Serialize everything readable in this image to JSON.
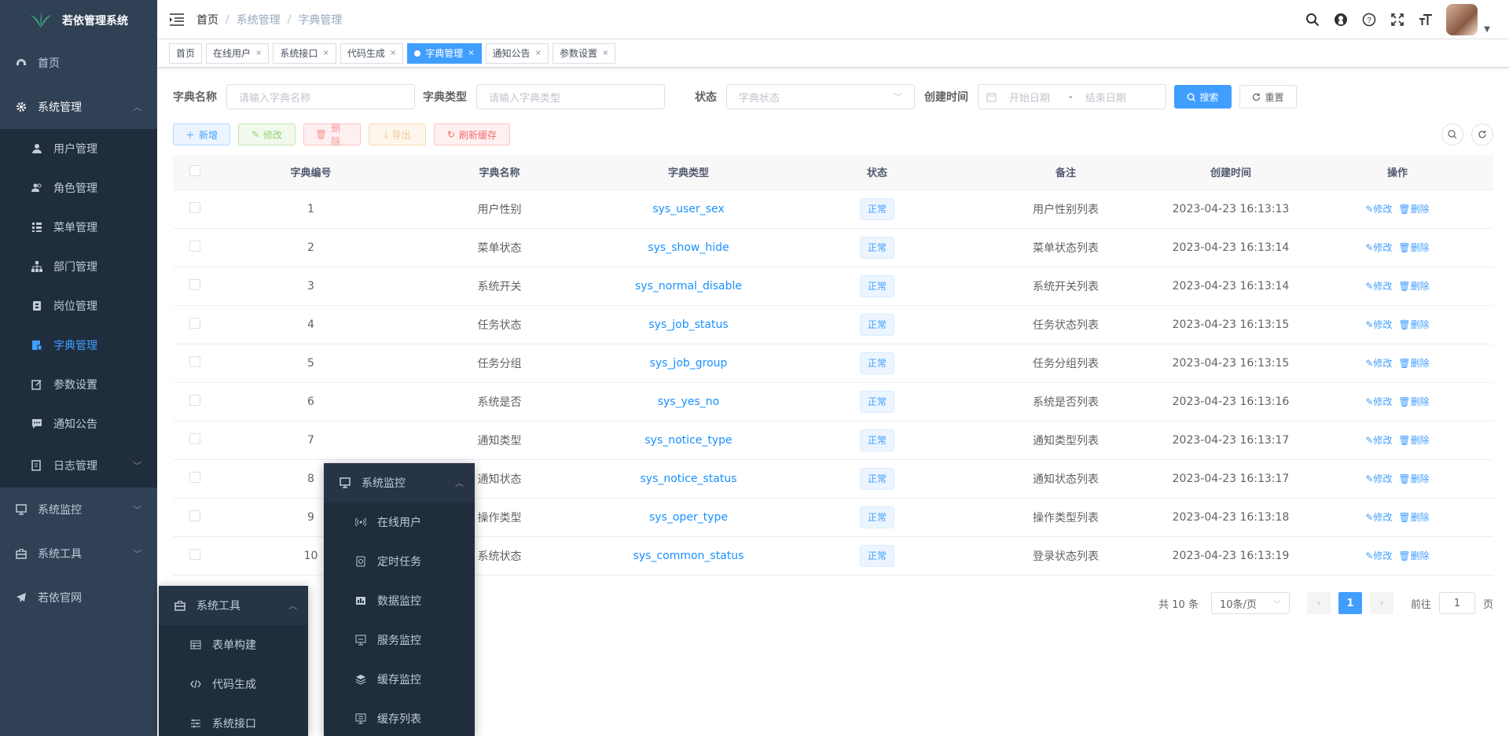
{
  "app": {
    "title": "若依管理系统"
  },
  "sidebar": {
    "items": [
      {
        "label": "首页",
        "icon": "dashboard-icon"
      },
      {
        "label": "系统管理",
        "icon": "gear-icon"
      },
      {
        "label": "系统监控",
        "icon": "monitor-icon"
      },
      {
        "label": "系统工具",
        "icon": "toolbox-icon"
      },
      {
        "label": "若依官网",
        "icon": "paper-plane-icon"
      }
    ],
    "system_sub": [
      {
        "label": "用户管理",
        "icon": "user-icon"
      },
      {
        "label": "角色管理",
        "icon": "peoples-icon"
      },
      {
        "label": "菜单管理",
        "icon": "tree-table-icon"
      },
      {
        "label": "部门管理",
        "icon": "tree-icon"
      },
      {
        "label": "岗位管理",
        "icon": "post-icon"
      },
      {
        "label": "字典管理",
        "icon": "dict-icon"
      },
      {
        "label": "参数设置",
        "icon": "edit-icon"
      },
      {
        "label": "通知公告",
        "icon": "message-icon"
      },
      {
        "label": "日志管理",
        "icon": "log-icon"
      }
    ]
  },
  "breadcrumb": [
    "首页",
    "系统管理",
    "字典管理"
  ],
  "tags": [
    "首页",
    "在线用户",
    "系统接口",
    "代码生成",
    "字典管理",
    "通知公告",
    "参数设置"
  ],
  "search": {
    "name_label": "字典名称",
    "name_placeholder": "请输入字典名称",
    "type_label": "字典类型",
    "type_placeholder": "请输入字典类型",
    "status_label": "状态",
    "status_placeholder": "字典状态",
    "time_label": "创建时间",
    "start_placeholder": "开始日期",
    "range_sep": "-",
    "end_placeholder": "结束日期",
    "search_btn": "搜索",
    "reset_btn": "重置"
  },
  "toolbar": {
    "add": "新增",
    "edit": "修改",
    "delete": "删除",
    "export": "导出",
    "refresh_cache": "刷新缓存"
  },
  "table": {
    "headers": [
      "字典编号",
      "字典名称",
      "字典类型",
      "状态",
      "备注",
      "创建时间",
      "操作"
    ],
    "rows": [
      {
        "id": "1",
        "name": "用户性别",
        "type": "sys_user_sex",
        "status": "正常",
        "remark": "用户性别列表",
        "time": "2023-04-23 16:13:13"
      },
      {
        "id": "2",
        "name": "菜单状态",
        "type": "sys_show_hide",
        "status": "正常",
        "remark": "菜单状态列表",
        "time": "2023-04-23 16:13:14"
      },
      {
        "id": "3",
        "name": "系统开关",
        "type": "sys_normal_disable",
        "status": "正常",
        "remark": "系统开关列表",
        "time": "2023-04-23 16:13:14"
      },
      {
        "id": "4",
        "name": "任务状态",
        "type": "sys_job_status",
        "status": "正常",
        "remark": "任务状态列表",
        "time": "2023-04-23 16:13:15"
      },
      {
        "id": "5",
        "name": "任务分组",
        "type": "sys_job_group",
        "status": "正常",
        "remark": "任务分组列表",
        "time": "2023-04-23 16:13:15"
      },
      {
        "id": "6",
        "name": "系统是否",
        "type": "sys_yes_no",
        "status": "正常",
        "remark": "系统是否列表",
        "time": "2023-04-23 16:13:16"
      },
      {
        "id": "7",
        "name": "通知类型",
        "type": "sys_notice_type",
        "status": "正常",
        "remark": "通知类型列表",
        "time": "2023-04-23 16:13:17"
      },
      {
        "id": "8",
        "name": "通知状态",
        "type": "sys_notice_status",
        "status": "正常",
        "remark": "通知状态列表",
        "time": "2023-04-23 16:13:17"
      },
      {
        "id": "9",
        "name": "操作类型",
        "type": "sys_oper_type",
        "status": "正常",
        "remark": "操作类型列表",
        "time": "2023-04-23 16:13:18"
      },
      {
        "id": "10",
        "name": "系统状态",
        "type": "sys_common_status",
        "status": "正常",
        "remark": "登录状态列表",
        "time": "2023-04-23 16:13:19"
      }
    ],
    "op_edit": "修改",
    "op_delete": "删除"
  },
  "pagination": {
    "total": "共 10 条",
    "page_size": "10条/页",
    "current": "1",
    "goto_label": "前往",
    "goto_value": "1",
    "page_unit": "页"
  },
  "popup_tools": {
    "title": "系统工具",
    "items": [
      {
        "label": "表单构建",
        "icon": "form-build-icon"
      },
      {
        "label": "代码生成",
        "icon": "code-icon"
      },
      {
        "label": "系统接口",
        "icon": "swagger-icon"
      }
    ]
  },
  "popup_monitor": {
    "title": "系统监控",
    "items": [
      {
        "label": "在线用户",
        "icon": "online-icon"
      },
      {
        "label": "定时任务",
        "icon": "job-icon"
      },
      {
        "label": "数据监控",
        "icon": "druid-icon"
      },
      {
        "label": "服务监控",
        "icon": "server-icon"
      },
      {
        "label": "缓存监控",
        "icon": "redis-icon"
      },
      {
        "label": "缓存列表",
        "icon": "redis-list-icon"
      }
    ]
  },
  "colors": {
    "primary": "#409eff",
    "sidebar_bg": "#304156",
    "submenu_bg": "#1f2d3d"
  }
}
